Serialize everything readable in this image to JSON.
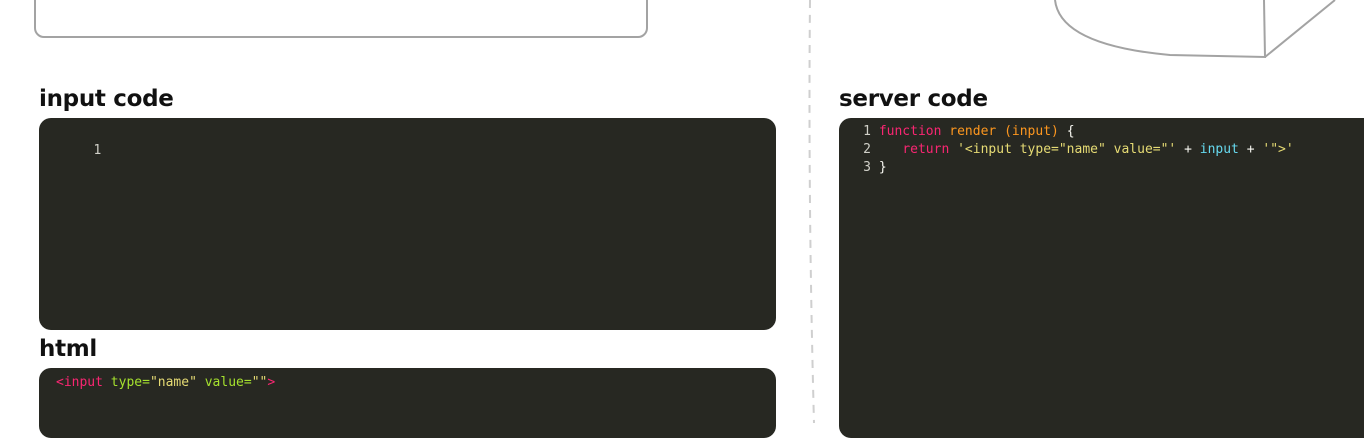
{
  "input_code": {
    "title": "input code",
    "lines": [
      {
        "num": "1",
        "text": ""
      }
    ]
  },
  "html_output": {
    "title": "html",
    "open": "<input",
    "type_attr": " type=",
    "type_val": "\"name\"",
    "value_attr": " value=",
    "value_val": "\"\"",
    "close": ">"
  },
  "server_code": {
    "title": "server code",
    "line1": {
      "num": "1",
      "keyword": "function",
      "fname": " render ",
      "params": "(input)",
      "brace": " {"
    },
    "line2": {
      "num": "2",
      "indent": "   ",
      "keyword": "return",
      "str1": " '<input type=\"name\" value=\"'",
      "plus1": " + ",
      "var": "input",
      "plus2": " + ",
      "str2": "'\">'"
    },
    "line3": {
      "num": "3",
      "brace": "}"
    }
  },
  "colors": {
    "editor_bg": "#272822",
    "keyword": "#f92672",
    "function": "#fd971f",
    "string": "#e6db74",
    "variable": "#66d9ef",
    "attribute": "#a6e22e"
  }
}
